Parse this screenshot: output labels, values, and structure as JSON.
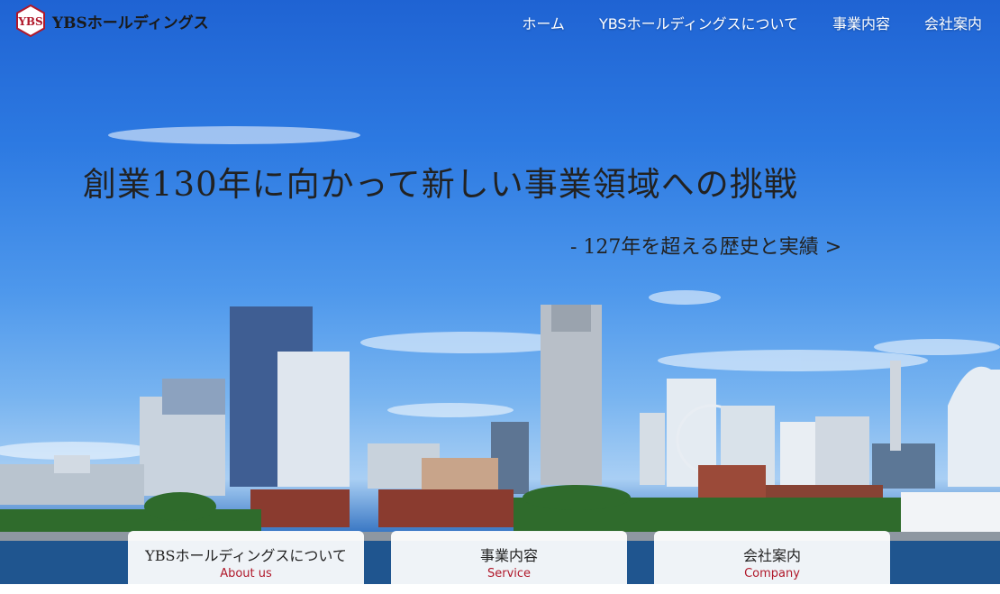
{
  "brand": {
    "name": "YBSホールディングス",
    "logo_text": "YBS"
  },
  "nav": [
    {
      "label": "ホーム"
    },
    {
      "label": "YBSホールディングスについて"
    },
    {
      "label": "事業内容"
    },
    {
      "label": "会社案内"
    }
  ],
  "hero": {
    "headline": "創業130年に向かって新しい事業領域への挑戦",
    "link": "- 127年を超える歴史と実績 >"
  },
  "cards": [
    {
      "title": "YBSホールディングスについて",
      "subtitle": "About us"
    },
    {
      "title": "事業内容",
      "subtitle": "Service"
    },
    {
      "title": "会社案内",
      "subtitle": "Company"
    }
  ],
  "colors": {
    "accent": "#b0182a",
    "sky": "#2d7ae2"
  }
}
